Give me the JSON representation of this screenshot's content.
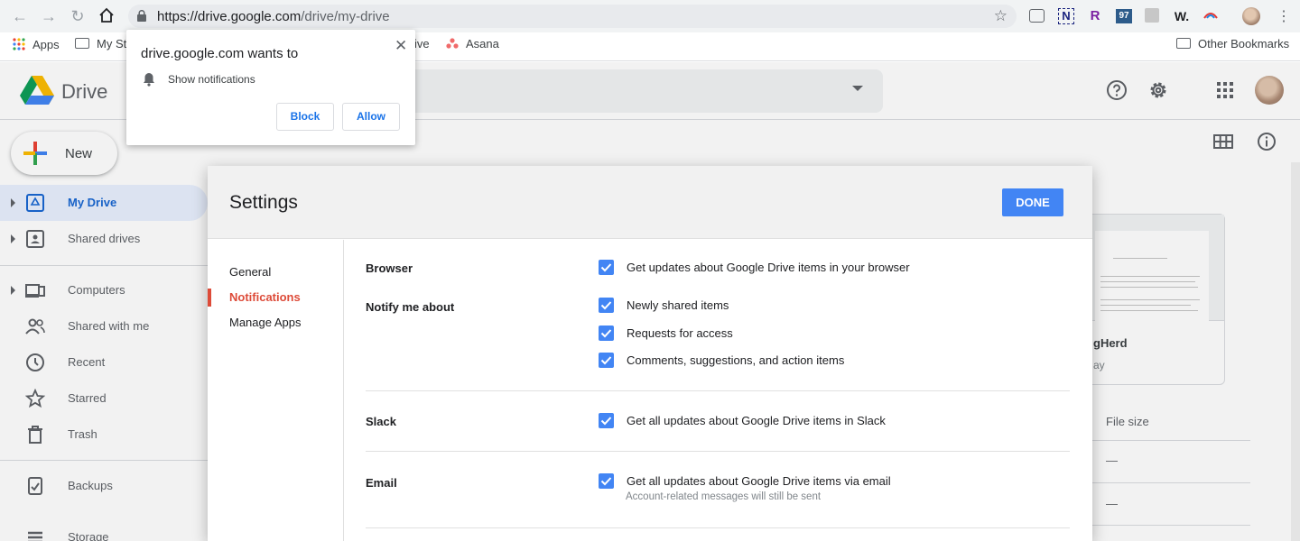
{
  "browser": {
    "url_host": "https://drive.google.com",
    "url_path": "/drive/my-drive",
    "extensions": [
      "R",
      "97",
      "W."
    ],
    "bookmarks": {
      "apps": "Apps",
      "my_stuff": "My St",
      "drive_fragment": "ive",
      "asana": "Asana",
      "other": "Other Bookmarks"
    }
  },
  "permission_popup": {
    "title": "drive.google.com wants to",
    "request": "Show notifications",
    "block_label": "Block",
    "allow_label": "Allow"
  },
  "drive": {
    "brand": "Drive",
    "new_button": "New",
    "sidebar": [
      {
        "label": "My Drive",
        "icon": "my-drive-icon",
        "active": true
      },
      {
        "label": "Shared drives",
        "icon": "shared-drives-icon"
      },
      {
        "label": "Computers",
        "icon": "computers-icon"
      },
      {
        "label": "Shared with me",
        "icon": "shared-with-me-icon"
      },
      {
        "label": "Recent",
        "icon": "clock-icon"
      },
      {
        "label": "Starred",
        "icon": "star-icon"
      },
      {
        "label": "Trash",
        "icon": "trash-icon"
      },
      {
        "label": "Backups",
        "icon": "backups-icon"
      },
      {
        "label": "Storage",
        "icon": "storage-icon"
      }
    ],
    "background": {
      "card_name": "gHerd",
      "card_sub": "ay",
      "file_size_header": "File size",
      "dash": "—"
    }
  },
  "settings": {
    "title": "Settings",
    "done": "DONE",
    "nav": [
      "General",
      "Notifications",
      "Manage Apps"
    ],
    "sections": {
      "browser": {
        "label": "Browser",
        "option": "Get updates about Google Drive items in your browser"
      },
      "notify": {
        "label": "Notify me about",
        "options": [
          "Newly shared items",
          "Requests for access",
          "Comments, suggestions, and action items"
        ]
      },
      "slack": {
        "label": "Slack",
        "option": "Get all updates about Google Drive items in Slack"
      },
      "email": {
        "label": "Email",
        "option": "Get all updates about Google Drive items via email",
        "note": "Account-related messages will still be sent"
      }
    }
  },
  "colors": {
    "accent": "#4285f4",
    "active_nav": "#dd4b39",
    "sidebar_active": "#1967d2"
  }
}
